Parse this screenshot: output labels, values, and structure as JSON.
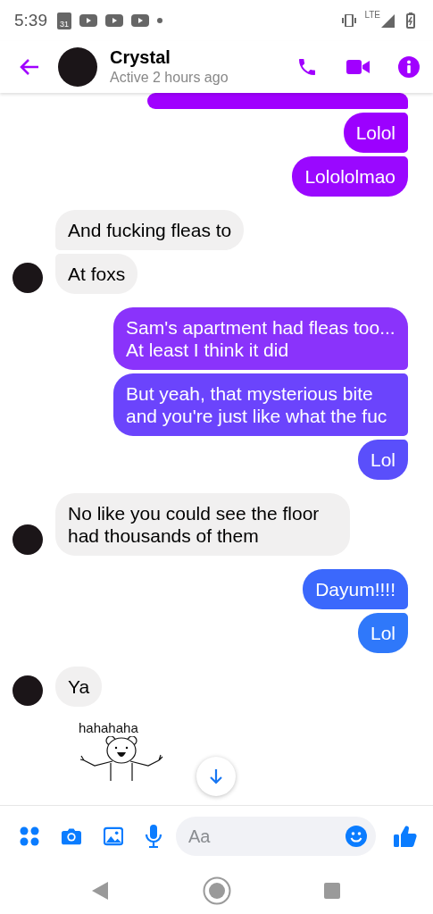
{
  "status_bar": {
    "time": "5:39",
    "calendar_day": "31",
    "network": "LTE"
  },
  "header": {
    "name": "Crystal",
    "status": "Active 2 hours ago"
  },
  "messages": [
    {
      "kind": "outgoing-cut",
      "color": "#a000ff"
    },
    {
      "kind": "outgoing",
      "text": "Lolol",
      "color": "#9c00ff"
    },
    {
      "kind": "outgoing",
      "text": "Lolololmao",
      "color": "#9a08ff"
    },
    {
      "kind": "incoming",
      "text": "And fucking fleas to",
      "avatar": false
    },
    {
      "kind": "incoming",
      "text": "At foxs",
      "avatar": true
    },
    {
      "kind": "outgoing",
      "text": "Sam's apartment had fleas too... At least I think it did",
      "color": "#8a33fb"
    },
    {
      "kind": "outgoing",
      "text": "But yeah, that mysterious bite and you're just like what the fuc",
      "color": "#6b44fc"
    },
    {
      "kind": "outgoing",
      "text": "Lol",
      "color": "#5a4ffb"
    },
    {
      "kind": "incoming",
      "text": "No like you could see the floor had thousands of them",
      "avatar": true
    },
    {
      "kind": "outgoing",
      "text": "Dayum!!!!",
      "color": "#3b68fc"
    },
    {
      "kind": "outgoing",
      "text": "Lol",
      "color": "#2f78fa"
    },
    {
      "kind": "incoming",
      "text": "Ya",
      "avatar": true
    },
    {
      "kind": "sticker",
      "caption": "hahahaha"
    }
  ],
  "composer": {
    "placeholder": "Aa"
  }
}
